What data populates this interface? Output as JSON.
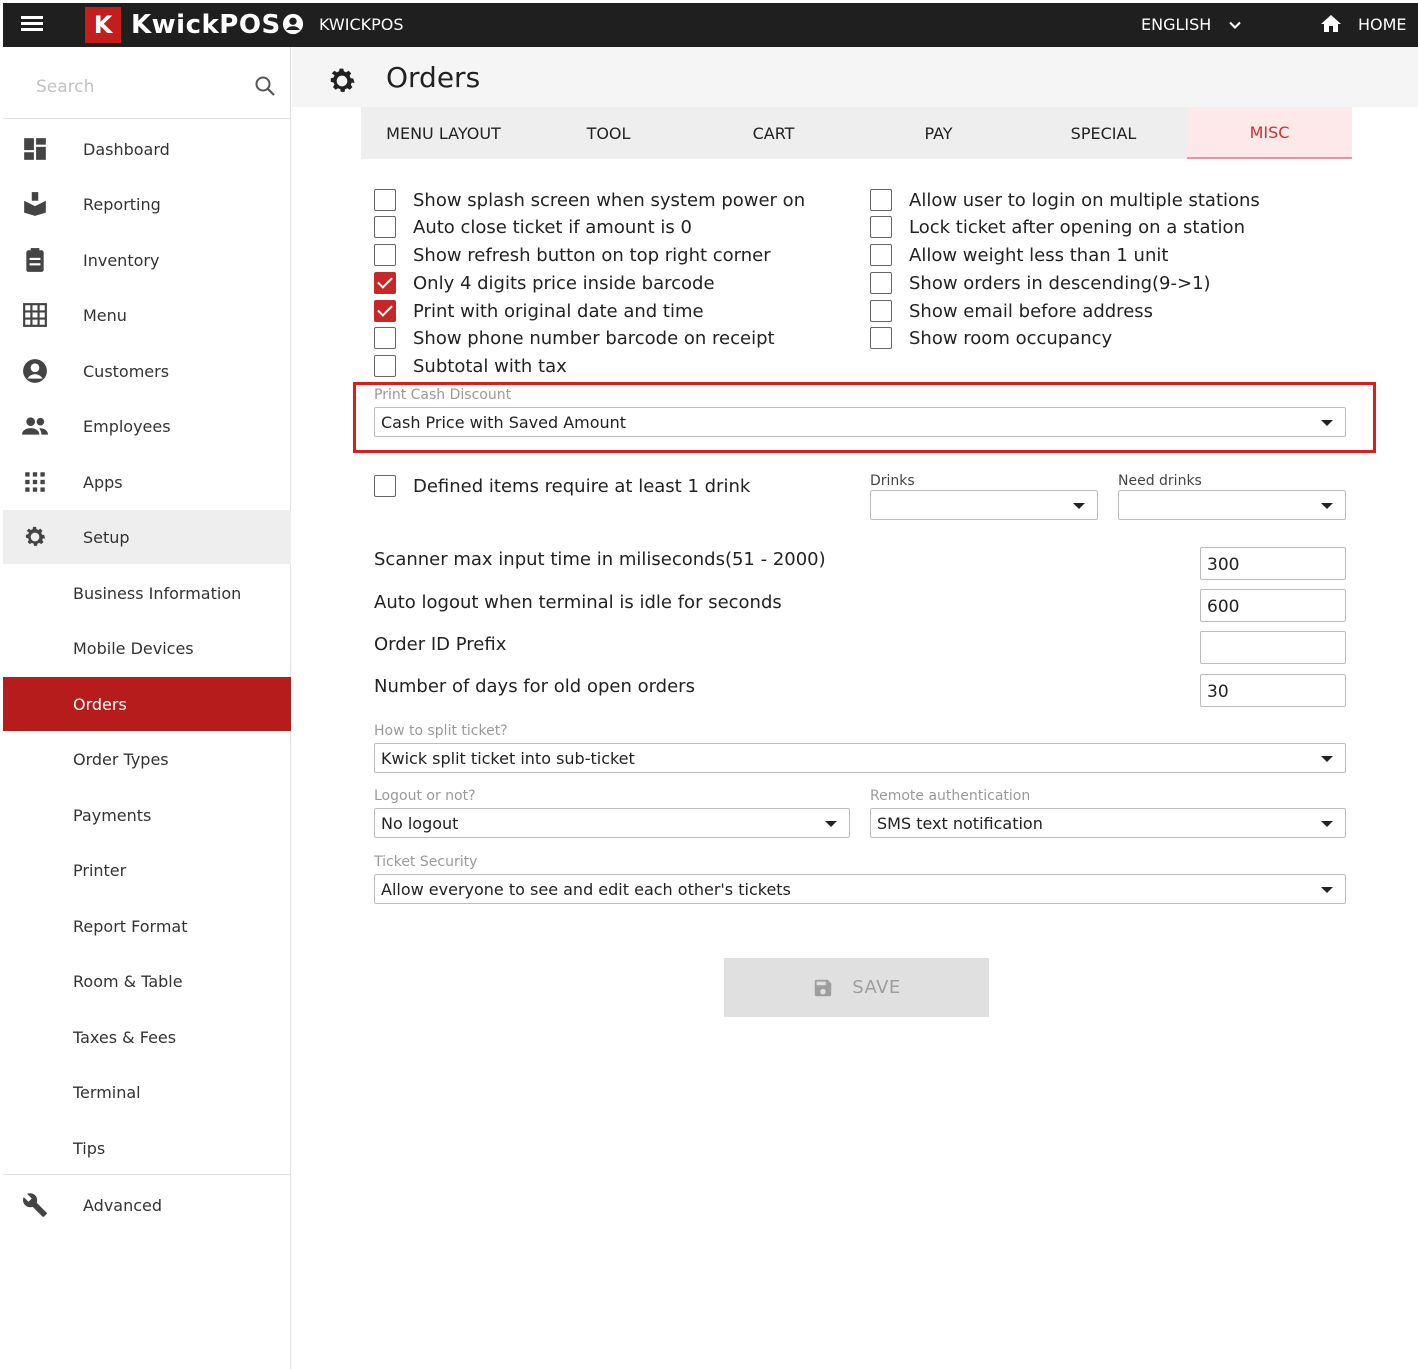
{
  "topbar": {
    "logo_letter": "K",
    "app_name": "KwickPOS",
    "account": "KWICKPOS",
    "language": "ENGLISH",
    "home": "HOME"
  },
  "sidebar": {
    "search_placeholder": "Search",
    "items": [
      {
        "label": "Dashboard",
        "icon": "dashboard-icon"
      },
      {
        "label": "Reporting",
        "icon": "reporting-icon"
      },
      {
        "label": "Inventory",
        "icon": "clipboard-icon"
      },
      {
        "label": "Menu",
        "icon": "grid-icon"
      },
      {
        "label": "Customers",
        "icon": "account-circle-icon"
      },
      {
        "label": "Employees",
        "icon": "people-icon"
      },
      {
        "label": "Apps",
        "icon": "apps-icon"
      },
      {
        "label": "Setup",
        "icon": "gear-icon"
      }
    ],
    "setup_children": [
      "Business Information",
      "Mobile Devices",
      "Orders",
      "Order Types",
      "Payments",
      "Printer",
      "Report Format",
      "Room & Table",
      "Taxes & Fees",
      "Terminal",
      "Tips"
    ],
    "active_child": "Orders",
    "advanced": {
      "label": "Advanced",
      "icon": "wrench-icon"
    }
  },
  "page": {
    "title": "Orders",
    "tabs": [
      "MENU LAYOUT",
      "TOOL",
      "CART",
      "PAY",
      "SPECIAL",
      "MISC"
    ],
    "active_tab": "MISC"
  },
  "checkboxes_left": [
    {
      "label": "Show splash screen when system power on",
      "checked": false
    },
    {
      "label": "Auto close ticket if amount is 0",
      "checked": false
    },
    {
      "label": "Show refresh button on top right corner",
      "checked": false
    },
    {
      "label": "Only 4 digits price inside barcode",
      "checked": true
    },
    {
      "label": "Print with original date and time",
      "checked": true
    },
    {
      "label": "Show phone number barcode on receipt",
      "checked": false
    },
    {
      "label": "Subtotal with tax",
      "checked": false
    }
  ],
  "checkboxes_right": [
    {
      "label": "Allow user to login on multiple stations",
      "checked": false
    },
    {
      "label": "Lock ticket after opening on a station",
      "checked": false
    },
    {
      "label": "Allow weight less than 1 unit",
      "checked": false
    },
    {
      "label": "Show orders in descending(9->1)",
      "checked": false
    },
    {
      "label": "Show email before address",
      "checked": false
    },
    {
      "label": "Show room occupancy",
      "checked": false
    }
  ],
  "print_cash_discount": {
    "label": "Print Cash Discount",
    "value": "Cash Price with Saved Amount"
  },
  "drink_requirement": {
    "label": "Defined items require at least 1 drink",
    "checked": false,
    "drinks_label": "Drinks",
    "drinks_value": "",
    "need_drinks_label": "Need drinks",
    "need_drinks_value": ""
  },
  "numeric_settings": [
    {
      "label": "Scanner max input time in miliseconds(51 - 2000)",
      "value": "300"
    },
    {
      "label": "Auto logout when terminal is idle for seconds",
      "value": "600"
    },
    {
      "label": "Order ID Prefix",
      "value": ""
    },
    {
      "label": "Number of days for old open orders",
      "value": "30"
    }
  ],
  "split_ticket": {
    "label": "How to split ticket?",
    "value": "Kwick split ticket into sub-ticket"
  },
  "logout": {
    "label": "Logout or not?",
    "value": "No logout"
  },
  "remote_auth": {
    "label": "Remote authentication",
    "value": "SMS text notification"
  },
  "ticket_security": {
    "label": "Ticket Security",
    "value": "Allow everyone to see and edit each other's tickets"
  },
  "save_label": "SAVE",
  "colors": {
    "brand_red": "#c41d1d",
    "active_nav": "#b71c1c",
    "topbar": "#1f1f1f",
    "highlight_box": "#e01b1b"
  }
}
